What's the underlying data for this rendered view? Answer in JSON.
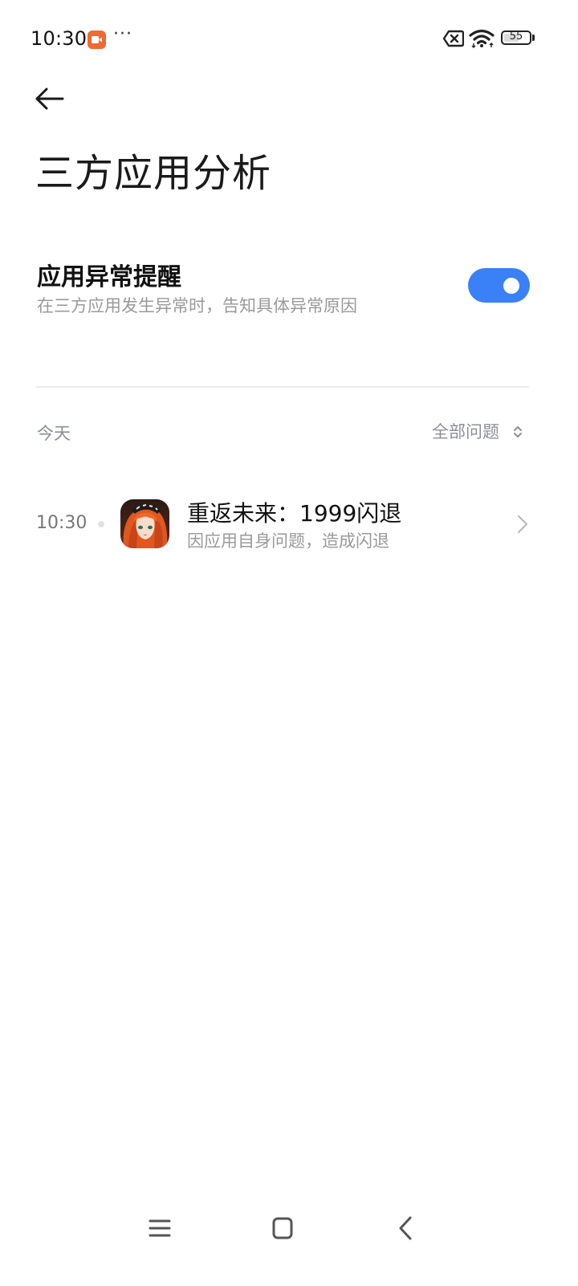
{
  "status_bar": {
    "time": "10:30",
    "more_indicator": "···",
    "battery_level": "55",
    "icons": [
      "screen-record-icon",
      "sim-off-icon",
      "wifi-icon",
      "battery-icon"
    ],
    "record_color": "#f06a32"
  },
  "header": {
    "back_icon": "arrow-left-icon",
    "title": "三方应用分析"
  },
  "setting": {
    "title": "应用异常提醒",
    "description": "在三方应用发生异常时，告知具体异常原因",
    "toggle_on": true,
    "toggle_color": "#3a80f6"
  },
  "list": {
    "date_label": "今天",
    "filter_label": "全部问题",
    "filter_icon": "chevron-up-down-icon",
    "items": [
      {
        "time": "10:30",
        "app_icon": "app-icon-reverse-1999",
        "title": "重返未来：1999闪退",
        "description": "因应用自身问题，造成闪退",
        "chevron_icon": "chevron-right-icon"
      }
    ]
  },
  "nav_bar": {
    "icons": [
      "menu-icon",
      "home-icon",
      "back-icon"
    ]
  }
}
